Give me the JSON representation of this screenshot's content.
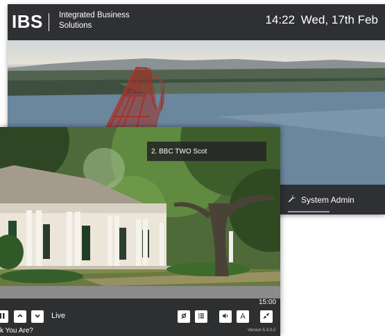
{
  "portal": {
    "logo": "IBS",
    "company": "Integrated Business Solutions",
    "time": "14:22",
    "date": "Wed, 17th Feb",
    "system_admin_label": "System Admin"
  },
  "player": {
    "channel_overlay": "2. BBC TWO Scot",
    "live_label": "Live",
    "end_time": "15:00",
    "programme_title": "k You Are?",
    "version": "Version 5.3.0-2",
    "subtitle_button_label": "A"
  },
  "icons": {
    "system_admin": "wrench-icon",
    "pause": "pause-icon",
    "channel_up": "chevron-up-icon",
    "channel_down": "chevron-down-icon",
    "record": "record-icon",
    "guide": "list-icon",
    "volume": "volume-icon",
    "subtitles": "subtitles-icon",
    "exit_fullscreen": "minimize-icon"
  },
  "colors": {
    "header_bg": "#2f3033",
    "player_bar_bg": "#2e2f31",
    "button_bg": "#ffffff",
    "overlay_bg": "#262626"
  }
}
